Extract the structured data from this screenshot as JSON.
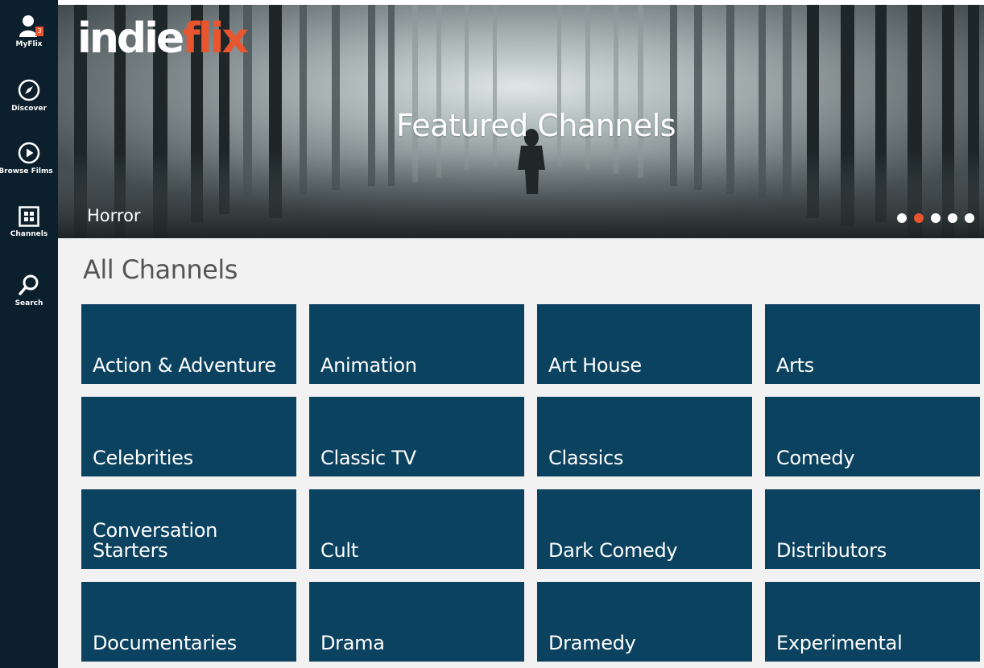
{
  "sidebar": {
    "items": [
      {
        "label": "MyFlix",
        "icon": "user-icon",
        "badge": "3"
      },
      {
        "label": "Discover",
        "icon": "compass-icon"
      },
      {
        "label": "Browse Films",
        "icon": "play-circle-icon"
      },
      {
        "label": "Channels",
        "icon": "grid-icon"
      },
      {
        "label": "Search",
        "icon": "search-icon"
      }
    ]
  },
  "hero": {
    "logo_part1": "indie",
    "logo_part2": "flix",
    "title": "Featured Channels",
    "caption": "Horror",
    "slides_total": 5,
    "active_slide": 2
  },
  "main": {
    "title": "All Channels",
    "channels": [
      "Action & Adventure",
      "Animation",
      "Art House",
      "Arts",
      "Celebrities",
      "Classic TV",
      "Classics",
      "Comedy",
      "Conversation Starters",
      "Cult",
      "Dark Comedy",
      "Distributors",
      "Documentaries",
      "Drama",
      "Dramedy",
      "Experimental"
    ]
  },
  "colors": {
    "sidebar_bg": "#0c1f2c",
    "tile_bg": "#0b4260",
    "accent": "#e8552f",
    "content_bg": "#f2f2f2"
  }
}
